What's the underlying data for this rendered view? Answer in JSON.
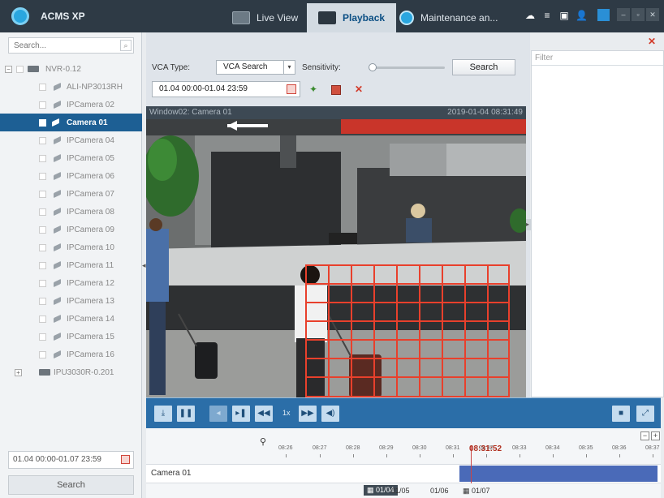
{
  "app": {
    "title": "ACMS XP"
  },
  "tabs": [
    {
      "label": "Live View",
      "icon": "live-view-icon"
    },
    {
      "label": "Playback",
      "icon": "playback-icon"
    },
    {
      "label": "Maintenance an...",
      "icon": "maintenance-icon"
    }
  ],
  "left": {
    "search_placeholder": "Search...",
    "tree": [
      {
        "label": "NVR-0.12",
        "kind": "device"
      },
      {
        "label": "ALI-NP3013RH",
        "kind": "camera"
      },
      {
        "label": "IPCamera 02",
        "kind": "camera"
      },
      {
        "label": "Camera 01",
        "kind": "camera",
        "selected": true
      },
      {
        "label": "IPCamera 04",
        "kind": "camera"
      },
      {
        "label": "IPCamera 05",
        "kind": "camera"
      },
      {
        "label": "IPCamera 06",
        "kind": "camera"
      },
      {
        "label": "IPCamera 07",
        "kind": "camera"
      },
      {
        "label": "IPCamera 08",
        "kind": "camera"
      },
      {
        "label": "IPCamera 09",
        "kind": "camera"
      },
      {
        "label": "IPCamera 10",
        "kind": "camera"
      },
      {
        "label": "IPCamera 11",
        "kind": "camera"
      },
      {
        "label": "IPCamera 12",
        "kind": "camera"
      },
      {
        "label": "IPCamera 13",
        "kind": "camera"
      },
      {
        "label": "IPCamera 14",
        "kind": "camera"
      },
      {
        "label": "IPCamera 15",
        "kind": "camera"
      },
      {
        "label": "IPCamera 16",
        "kind": "camera"
      },
      {
        "label": "IPU3030R-0.201",
        "kind": "device"
      }
    ],
    "range": "01.04 00:00-01.07 23:59",
    "search_button": "Search"
  },
  "vca": {
    "type_label": "VCA Type:",
    "type_value": "VCA Search",
    "sensitivity_label": "Sensitivity:",
    "sensitivity_value": 0,
    "search_button": "Search",
    "time_range": "01.04 00:00-01.04 23:59"
  },
  "video": {
    "window_title": "Window02: Camera 01",
    "timestamp": "2019-01-04 08:31:49"
  },
  "controls": {
    "speed": "1x"
  },
  "filter": {
    "placeholder": "Filter"
  },
  "timeline": {
    "ticks": [
      "08:26",
      "08:27",
      "08:28",
      "08:29",
      "08:30",
      "08:31",
      "08:32",
      "08:33",
      "08:34",
      "08:35",
      "08:36",
      "08:37"
    ],
    "cursor": "08:31:52",
    "camera": "Camera 01",
    "dates": [
      "01/04",
      "01/05",
      "01/06",
      "01/07"
    ],
    "active_date": "01/04"
  },
  "colors": {
    "accent": "#2b6ea8",
    "selected": "#1d5f94",
    "record": "#4a6ab8",
    "grid": "#e8402c"
  }
}
